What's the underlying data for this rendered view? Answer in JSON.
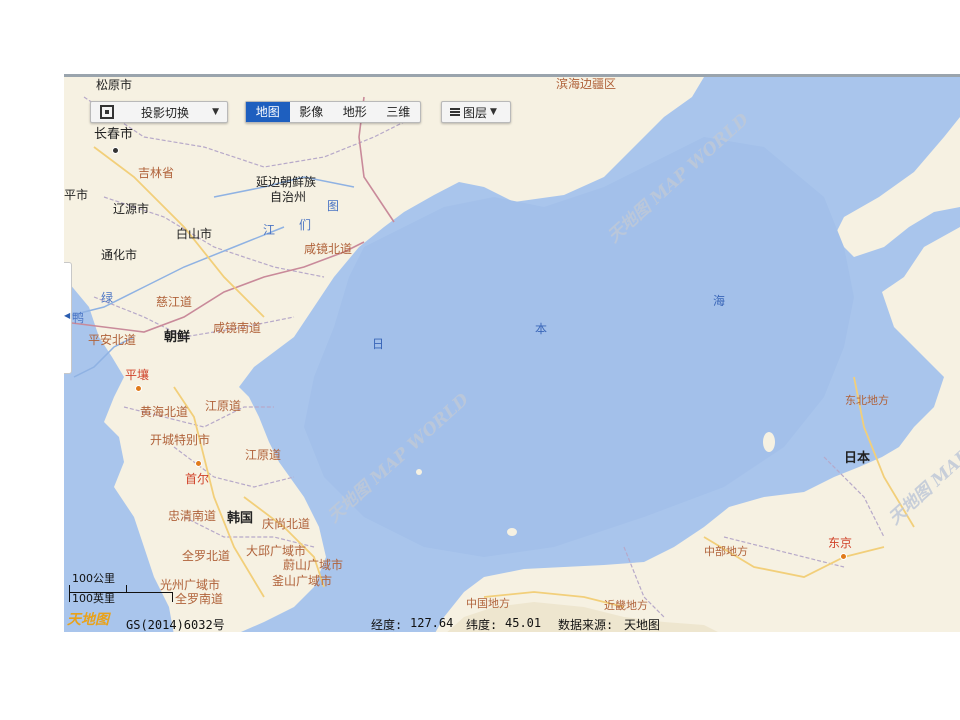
{
  "toolbar": {
    "projection_label": "投影切换",
    "map_types": [
      "地图",
      "影像",
      "地形",
      "三维"
    ],
    "active_type": "地图",
    "layers_label": "图层"
  },
  "map": {
    "watermark": "天地图 MAP WORLD",
    "labels": {
      "songyuan": "松原市",
      "binhai": "滨海边疆区",
      "changchun": "长春市",
      "jilin": "吉林省",
      "yanbian1": "延边朝鲜族",
      "yanbian2": "自治州",
      "siping": "平市",
      "liaoyuan": "辽源市",
      "baishan": "白山市",
      "tonghua": "通化市",
      "jiang": "江",
      "men": "们",
      "tu": "图",
      "xianjingbei": "咸镜北道",
      "lu": "绿",
      "ya": "鸭",
      "cijiang": "慈江道",
      "chaoxian": "朝鲜",
      "xianjingnan": "咸镜南道",
      "pinganbei": "平安北道",
      "pyongyang": "平壤",
      "huanghaibei": "黄海北道",
      "jiangyuan1": "江原道",
      "kaicheng": "开城特别市",
      "jiangyuan2": "江原道",
      "seoul": "首尔",
      "zhongqingnan": "忠清南道",
      "hanguo": "韩国",
      "qingshangbei": "庆尚北道",
      "daqiu": "大邱广域市",
      "quanluobei": "全罗北道",
      "weishan": "蔚山广域市",
      "guangzhou": "光州广域市",
      "fushan": "釜山广域市",
      "quanluonan": "全罗南道",
      "sea_ri": "日",
      "sea_ben": "本",
      "sea_hai": "海",
      "dongbei": "东北地方",
      "riben": "日本",
      "zhongbu": "中部地方",
      "dongjing": "东京",
      "zhongguo": "中国地方",
      "jinji": "近畿地方"
    }
  },
  "scale": {
    "km_label": "100公里",
    "mi_label": "100英里"
  },
  "footer": {
    "logo_text": "天地图",
    "license": "GS(2014)6032号",
    "lon_label": "经度:",
    "lon_value": "127.64",
    "lat_label": "纬度:",
    "lat_value": "45.01",
    "source_label": "数据来源:",
    "source_value": "天地图"
  },
  "colors": {
    "sea": "#a9c5ec",
    "land": "#f6f1e2",
    "active_tab": "#1e5fbf",
    "province_label": "#b0623a"
  }
}
